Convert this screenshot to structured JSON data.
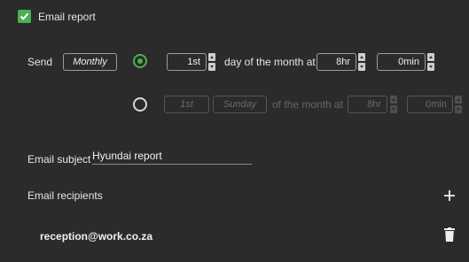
{
  "email_report": {
    "label": "Email report",
    "checked": true
  },
  "schedule": {
    "send_label": "Send",
    "frequency": "Monthly",
    "option_by_day": {
      "selected": true,
      "day_value": "1st",
      "mid_text": "day of the month at",
      "hour_value": "8hr",
      "minute_value": "0min"
    },
    "option_by_weekday": {
      "selected": false,
      "ordinal_value": "1st",
      "weekday_value": "Sunday",
      "mid_text": "of the month at",
      "hour_value": "8hr",
      "minute_value": "0min"
    }
  },
  "subject": {
    "label": "Email subject",
    "value": "Hyundai report"
  },
  "recipients": {
    "label": "Email recipients",
    "items": [
      {
        "email": "reception@work.co.za"
      }
    ]
  },
  "colors": {
    "accent": "#4caf50",
    "background": "#2b2b2b"
  }
}
